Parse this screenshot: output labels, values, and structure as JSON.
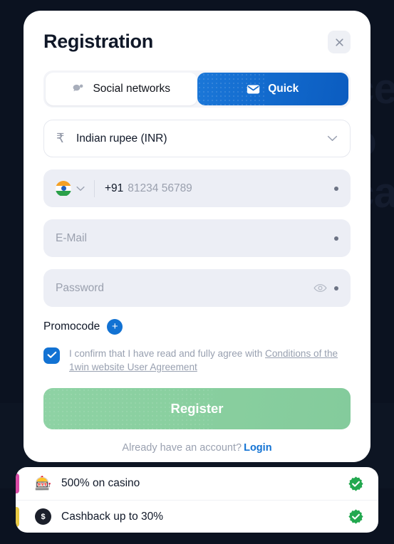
{
  "background": {
    "ghost_text": "ce\no\nca",
    "color": "#0b1220"
  },
  "modal": {
    "title": "Registration",
    "close_icon": "close-icon",
    "tabs": [
      {
        "label": "Social networks",
        "icon": "chat-bubble-icon",
        "active": false
      },
      {
        "label": "Quick",
        "icon": "envelope-icon",
        "active": true
      }
    ],
    "currency": {
      "symbol": "₹",
      "value": "Indian rupee (INR)",
      "chevron_icon": "chevron-down-icon"
    },
    "phone": {
      "flag": "india-flag-icon",
      "chevron_icon": "chevron-down-icon",
      "country_code": "+91",
      "placeholder": "81234 56789",
      "value": ""
    },
    "email": {
      "placeholder": "E-Mail",
      "value": ""
    },
    "password": {
      "placeholder": "Password",
      "value": "",
      "eye_icon": "eye-icon"
    },
    "promocode": {
      "label": "Promocode",
      "add_label": "+"
    },
    "agreement": {
      "text_before": "I confirm that I have read and fully agree with ",
      "link_text": "Conditions of the 1win website User Agreement",
      "checked": true
    },
    "register_button": "Register",
    "footer": {
      "prompt": "Already have an account?",
      "login_label": "Login"
    }
  },
  "bonus_bar": {
    "rows": [
      {
        "icon": "slot-machine-icon",
        "glyph": "🎰",
        "label": "500% on casino",
        "tab_color": "#d94ba6",
        "status_icon": "verified-check-icon"
      },
      {
        "icon": "cashback-icon",
        "glyph": "$",
        "label": "Cashback up to 30%",
        "tab_color": "#e8c944",
        "status_icon": "verified-check-icon"
      }
    ]
  },
  "colors": {
    "accent_blue": "#1272d3",
    "register_green": "#89cf9f",
    "field_gray": "#eceef5",
    "verified_green": "#22a84f"
  }
}
